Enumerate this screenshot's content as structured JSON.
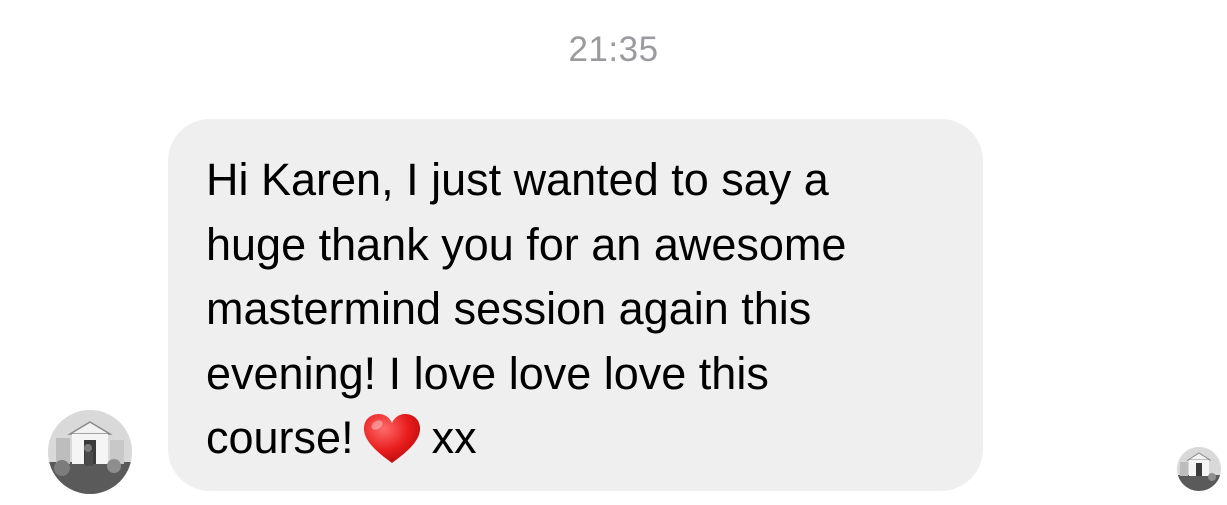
{
  "conversation": {
    "timestamp": "21:35",
    "message": {
      "text_main": "Hi Karen, I just wanted to say a\nhuge thank you for an awesome\nmastermind session again this\nevening! I love love love this\ncourse!",
      "emoji": "heart-emoji",
      "text_tail": "xx",
      "bubble_color": "#efefef"
    },
    "sender_avatar": {
      "icon": "avatar-photo"
    },
    "read_receipt": {
      "icon": "avatar-photo"
    }
  }
}
